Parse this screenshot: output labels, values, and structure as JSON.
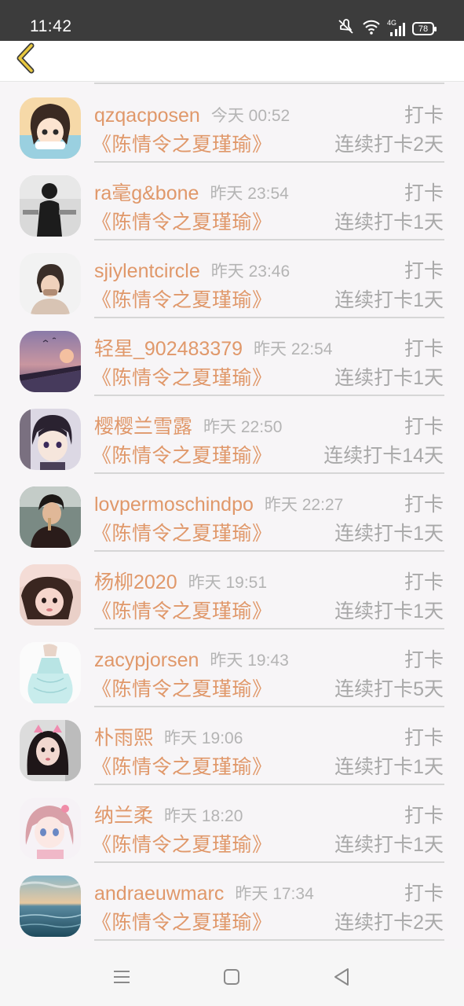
{
  "status_bar": {
    "time": "11:42",
    "network": "4G",
    "battery": "78",
    "icons": [
      "mute-icon",
      "wifi-icon",
      "signal-icon",
      "battery-icon"
    ]
  },
  "top_bar": {
    "back_icon": "chevron-left-icon",
    "accent": "#e8c840"
  },
  "colors": {
    "name": "#e0986a",
    "meta": "#b4b4b4",
    "action": "#a8a8a8",
    "divider": "#d6d6d6"
  },
  "list": [
    {
      "name": "qzqacposen",
      "time": "今天 00:52",
      "action": "打卡",
      "book": "《陈情令之夏瑾瑜》",
      "streak": "连续打卡2天",
      "avatar": "anime-girl-avatar"
    },
    {
      "name": "ra毫g&bone",
      "time": "昨天 23:54",
      "action": "打卡",
      "book": "《陈情令之夏瑾瑜》",
      "streak": "连续打卡1天",
      "avatar": "dark-figure-avatar"
    },
    {
      "name": "sjiylentcircle",
      "time": "昨天 23:46",
      "action": "打卡",
      "book": "《陈情令之夏瑾瑜》",
      "streak": "连续打卡1天",
      "avatar": "portrait-avatar"
    },
    {
      "name": "轻星_902483379",
      "time": "昨天 22:54",
      "action": "打卡",
      "book": "《陈情令之夏瑾瑜》",
      "streak": "连续打卡1天",
      "avatar": "sunset-avatar"
    },
    {
      "name": "樱樱兰雪露",
      "time": "昨天 22:50",
      "action": "打卡",
      "book": "《陈情令之夏瑾瑜》",
      "streak": "连续打卡14天",
      "avatar": "anime-boy-avatar"
    },
    {
      "name": "lovpermoschindpo",
      "time": "昨天 22:27",
      "action": "打卡",
      "book": "《陈情令之夏瑾瑜》",
      "streak": "连续打卡1天",
      "avatar": "man-photo-avatar"
    },
    {
      "name": "杨柳2020",
      "time": "昨天 19:51",
      "action": "打卡",
      "book": "《陈情令之夏瑾瑜》",
      "streak": "连续打卡1天",
      "avatar": "girl-pink-avatar"
    },
    {
      "name": "zacypjorsen",
      "time": "昨天 19:43",
      "action": "打卡",
      "book": "《陈情令之夏瑾瑜》",
      "streak": "连续打卡5天",
      "avatar": "dress-avatar"
    },
    {
      "name": "朴雨熙",
      "time": "昨天 19:06",
      "action": "打卡",
      "book": "《陈情令之夏瑾瑜》",
      "streak": "连续打卡1天",
      "avatar": "girl-cat-avatar"
    },
    {
      "name": "纳兰柔",
      "time": "昨天 18:20",
      "action": "打卡",
      "book": "《陈情令之夏瑾瑜》",
      "streak": "连续打卡1天",
      "avatar": "anime-pink-avatar"
    },
    {
      "name": "andraeuwmarc",
      "time": "昨天 17:34",
      "action": "打卡",
      "book": "《陈情令之夏瑾瑜》",
      "streak": "连续打卡2天",
      "avatar": "seascape-avatar"
    }
  ],
  "nav_bar": {
    "menu_icon": "menu-icon",
    "home_icon": "home-square-icon",
    "back_icon": "back-triangle-icon"
  }
}
